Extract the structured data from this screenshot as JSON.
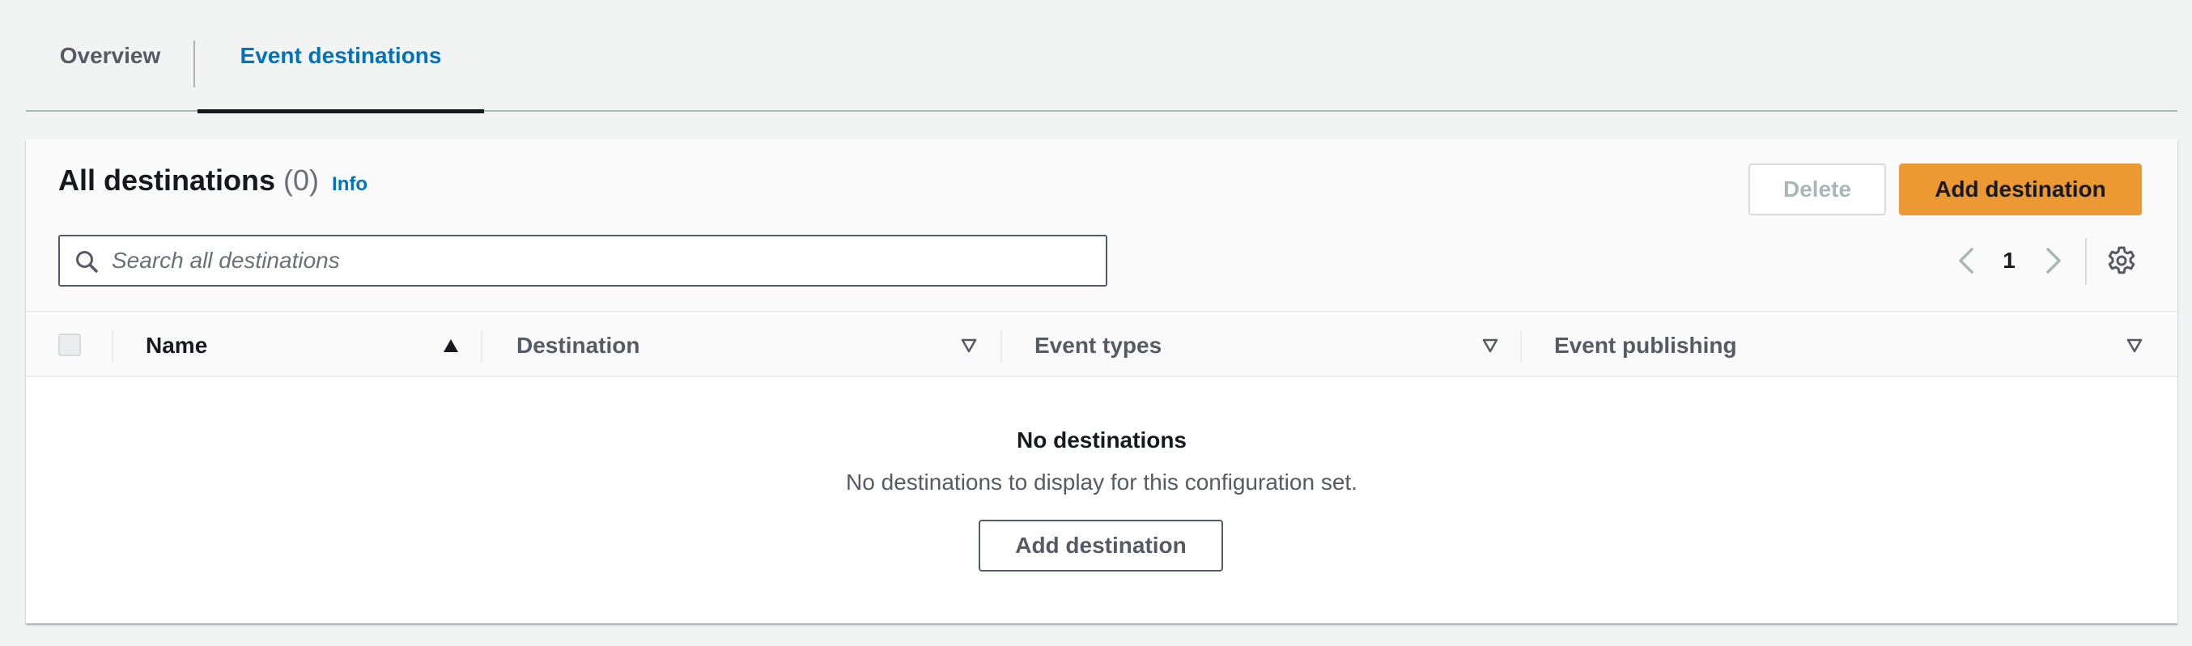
{
  "tabs": {
    "overview": "Overview",
    "event_destinations": "Event destinations"
  },
  "header": {
    "title": "All destinations",
    "count": "(0)",
    "info": "Info",
    "delete_label": "Delete",
    "add_label": "Add destination"
  },
  "search": {
    "placeholder": "Search all destinations",
    "value": ""
  },
  "pagination": {
    "current_page": "1"
  },
  "table": {
    "columns": [
      {
        "label": "Name",
        "sort": "ascending"
      },
      {
        "label": "Destination",
        "sort": "none"
      },
      {
        "label": "Event types",
        "sort": "none"
      },
      {
        "label": "Event publishing",
        "sort": "none"
      }
    ]
  },
  "empty_state": {
    "title": "No destinations",
    "description": "No destinations to display for this configuration set.",
    "button_label": "Add destination"
  },
  "colors": {
    "accent": "#ec9933",
    "link": "#0073bb",
    "text": "#16191f",
    "muted": "#545b64"
  }
}
